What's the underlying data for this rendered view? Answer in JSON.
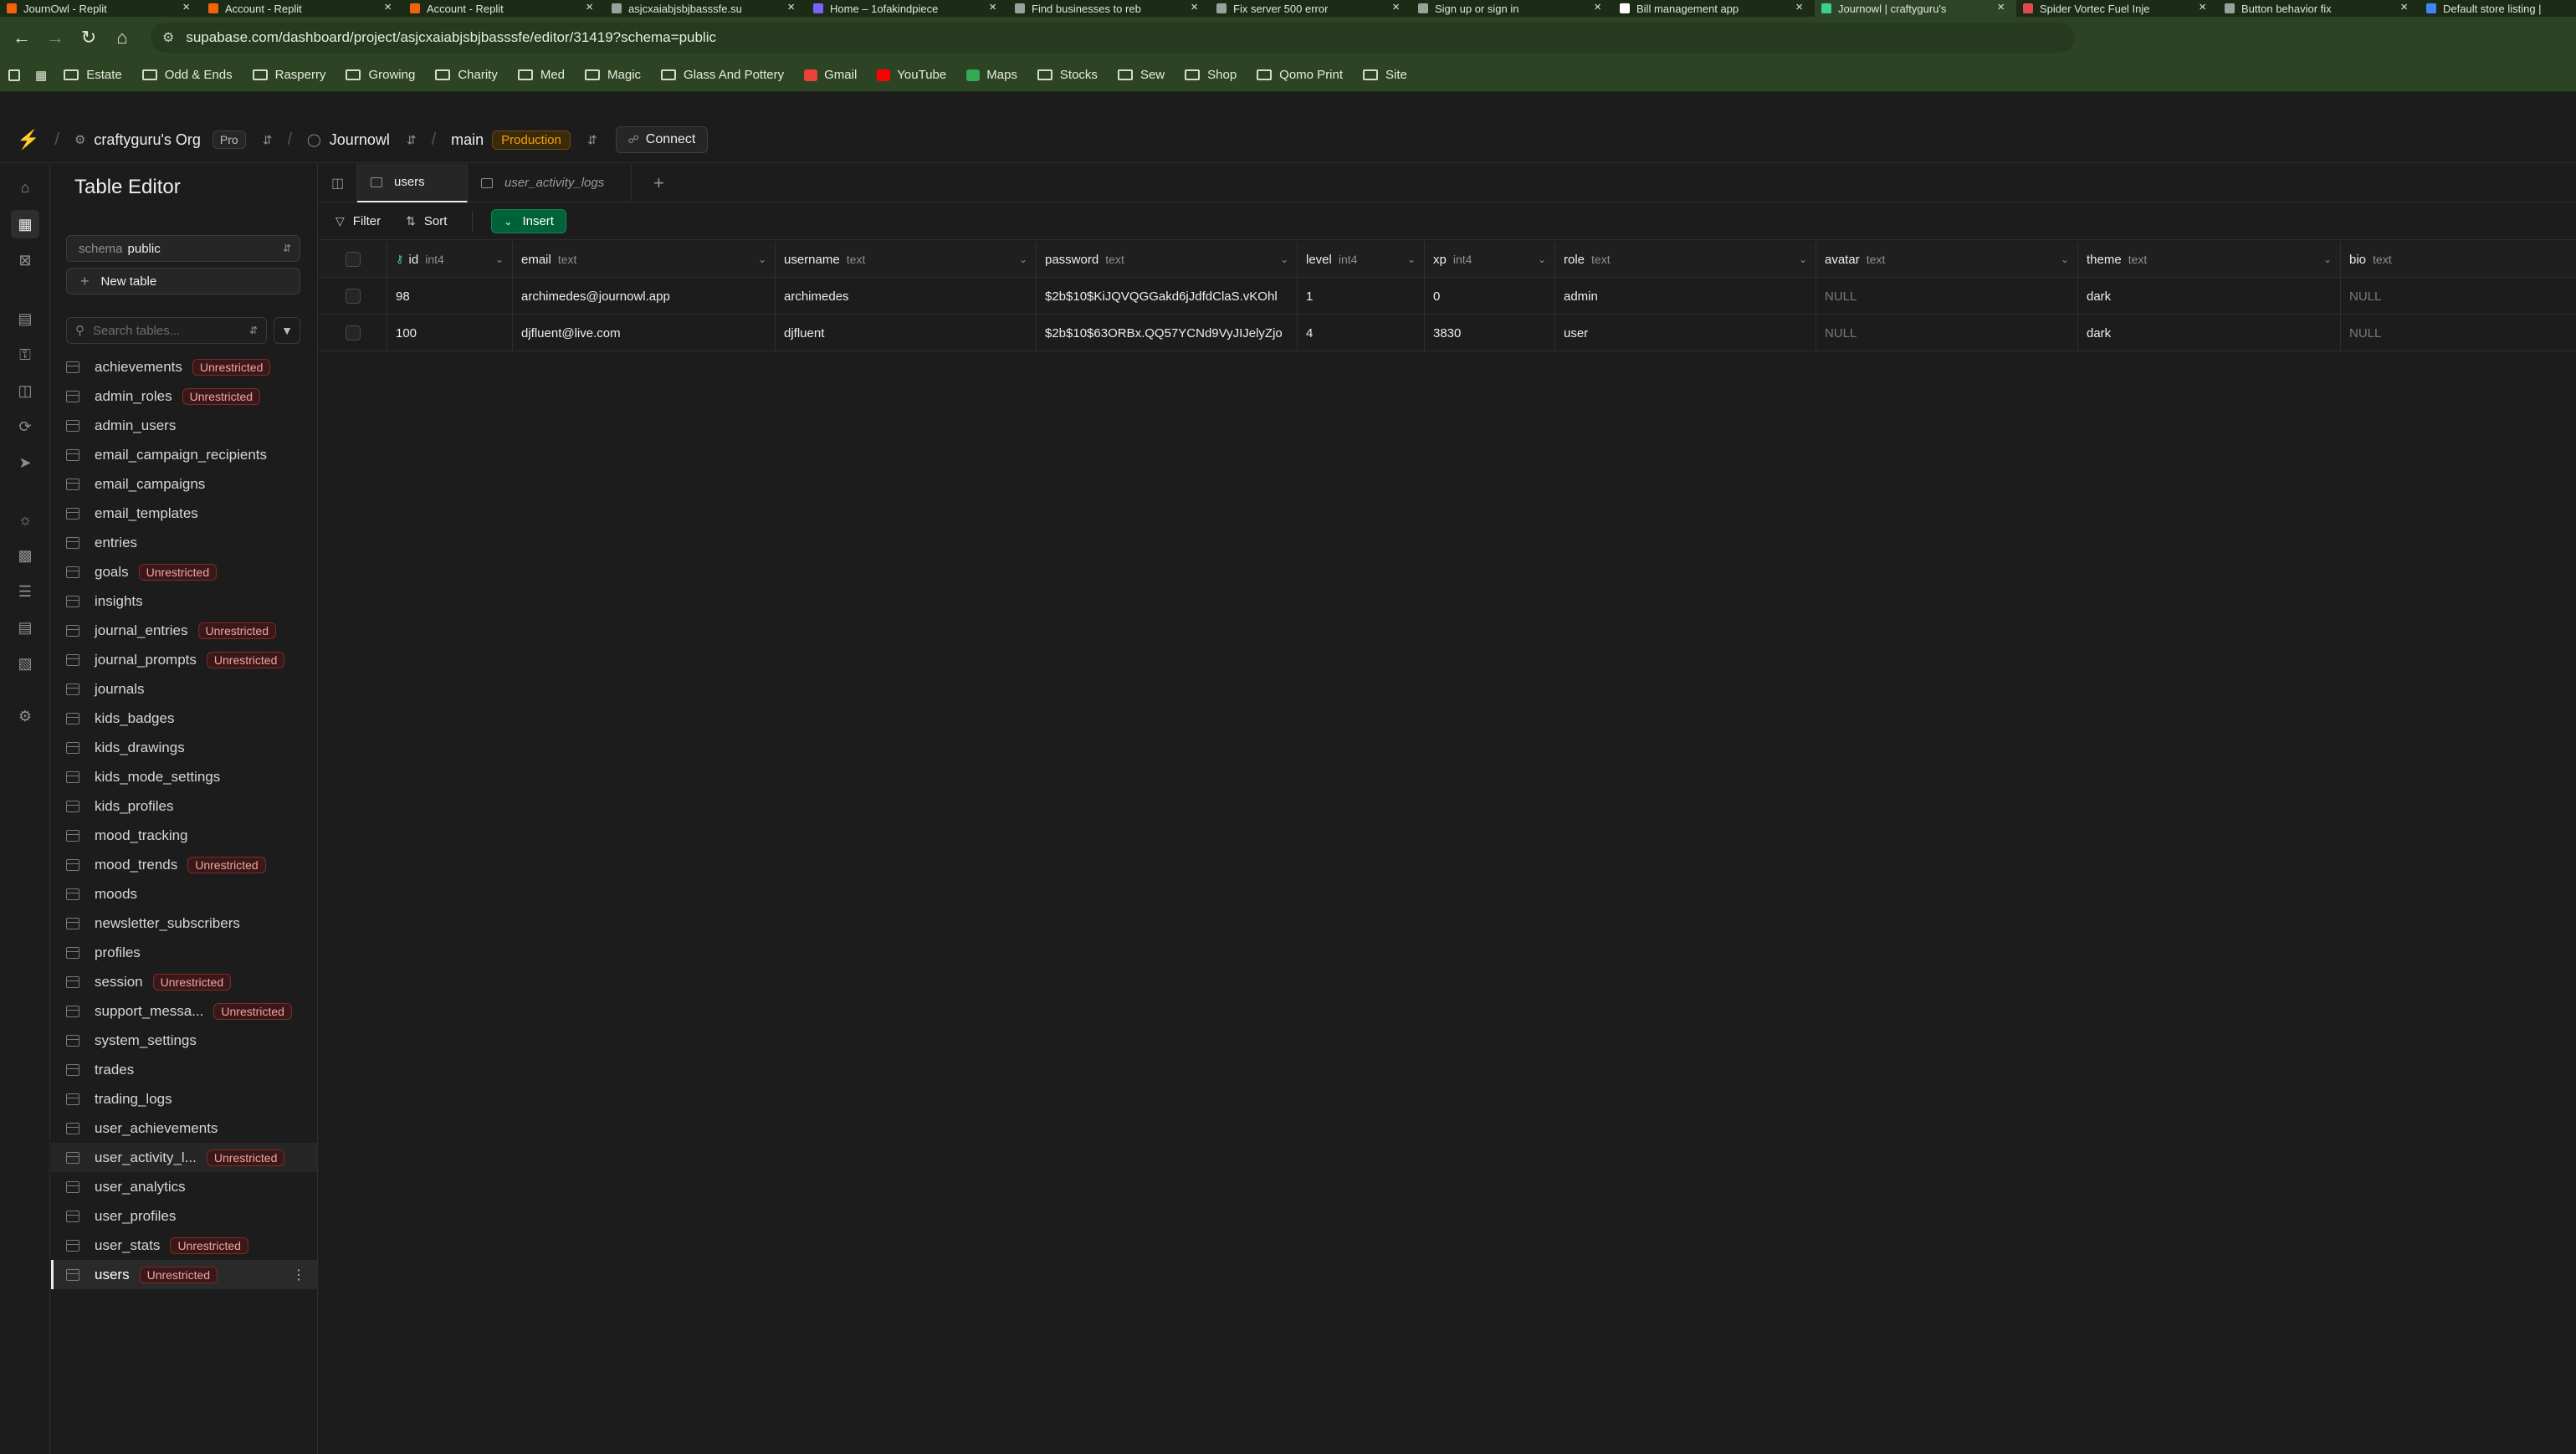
{
  "browser": {
    "tabs": [
      {
        "title": "JournOwl - Replit",
        "color": "#f26207"
      },
      {
        "title": "Account - Replit",
        "color": "#f26207"
      },
      {
        "title": "Account - Replit",
        "color": "#f26207"
      },
      {
        "title": "asjcxaiabjsbjbasssfe.su",
        "color": "#9aa19a"
      },
      {
        "title": "Home – 1ofakindpiece",
        "color": "#7b61ff"
      },
      {
        "title": "Find businesses to reb",
        "color": "#9aa19a"
      },
      {
        "title": "Fix server 500 error",
        "color": "#9aa19a"
      },
      {
        "title": "Sign up or sign in",
        "color": "#9aa19a"
      },
      {
        "title": "Bill management app",
        "color": "#ffffff"
      },
      {
        "title": "Journowl | craftyguru's",
        "color": "#3ecf8e"
      },
      {
        "title": "Spider Vortec Fuel Inje",
        "color": "#e04a4a"
      },
      {
        "title": "Button behavior fix",
        "color": "#9aa19a"
      },
      {
        "title": "Default store listing | ",
        "color": "#4285f4"
      }
    ],
    "active_tab_index": 9,
    "url": "supabase.com/dashboard/project/asjcxaiabjsbjbasssfe/editor/31419?schema=public",
    "bookmarks": [
      "Estate",
      "Odd & Ends",
      "Rasperry",
      "Growing",
      "Charity",
      "Med",
      "Magic",
      "Glass And Pottery",
      "Gmail",
      "YouTube",
      "Maps",
      "Stocks",
      "Sew",
      "Shop",
      "Qomo Print",
      "Site"
    ]
  },
  "topbar": {
    "org": "craftyguru's Org",
    "plan": "Pro",
    "project": "Journowl",
    "branch": "main",
    "env": "Production",
    "connect": "Connect"
  },
  "sidebar": {
    "title": "Table Editor",
    "schema_label": "schema",
    "schema_value": "public",
    "new_table": "New table",
    "search_placeholder": "Search tables...",
    "unrestricted_label": "Unrestricted",
    "tables": [
      {
        "name": "achievements",
        "unrestricted": true
      },
      {
        "name": "admin_roles",
        "unrestricted": true
      },
      {
        "name": "admin_users",
        "unrestricted": false
      },
      {
        "name": "email_campaign_recipients",
        "unrestricted": false
      },
      {
        "name": "email_campaigns",
        "unrestricted": false
      },
      {
        "name": "email_templates",
        "unrestricted": false
      },
      {
        "name": "entries",
        "unrestricted": false
      },
      {
        "name": "goals",
        "unrestricted": true
      },
      {
        "name": "insights",
        "unrestricted": false
      },
      {
        "name": "journal_entries",
        "unrestricted": true
      },
      {
        "name": "journal_prompts",
        "unrestricted": true
      },
      {
        "name": "journals",
        "unrestricted": false
      },
      {
        "name": "kids_badges",
        "unrestricted": false
      },
      {
        "name": "kids_drawings",
        "unrestricted": false
      },
      {
        "name": "kids_mode_settings",
        "unrestricted": false
      },
      {
        "name": "kids_profiles",
        "unrestricted": false
      },
      {
        "name": "mood_tracking",
        "unrestricted": false
      },
      {
        "name": "mood_trends",
        "unrestricted": true
      },
      {
        "name": "moods",
        "unrestricted": false
      },
      {
        "name": "newsletter_subscribers",
        "unrestricted": false
      },
      {
        "name": "profiles",
        "unrestricted": false
      },
      {
        "name": "session",
        "unrestricted": true
      },
      {
        "name": "support_messa...",
        "unrestricted": true
      },
      {
        "name": "system_settings",
        "unrestricted": false
      },
      {
        "name": "trades",
        "unrestricted": false
      },
      {
        "name": "trading_logs",
        "unrestricted": false
      },
      {
        "name": "user_achievements",
        "unrestricted": false
      },
      {
        "name": "user_activity_l...",
        "unrestricted": true
      },
      {
        "name": "user_analytics",
        "unrestricted": false
      },
      {
        "name": "user_profiles",
        "unrestricted": false
      },
      {
        "name": "user_stats",
        "unrestricted": true
      },
      {
        "name": "users",
        "unrestricted": true
      }
    ],
    "selected_index": 31,
    "hover_index": 27
  },
  "editor": {
    "tabs": [
      {
        "label": "users",
        "active": true,
        "italic": false
      },
      {
        "label": "user_activity_logs",
        "active": false,
        "italic": true
      }
    ],
    "toolbar": {
      "filter": "Filter",
      "sort": "Sort",
      "insert": "Insert"
    },
    "columns": [
      {
        "name": "id",
        "type": "int4",
        "key": true
      },
      {
        "name": "email",
        "type": "text"
      },
      {
        "name": "username",
        "type": "text"
      },
      {
        "name": "password",
        "type": "text"
      },
      {
        "name": "level",
        "type": "int4"
      },
      {
        "name": "xp",
        "type": "int4"
      },
      {
        "name": "role",
        "type": "text"
      },
      {
        "name": "avatar",
        "type": "text"
      },
      {
        "name": "theme",
        "type": "text"
      },
      {
        "name": "bio",
        "type": "text"
      }
    ],
    "rows": [
      [
        "98",
        "archimedes@journowl.app",
        "archimedes",
        "$2b$10$KiJQVQGGakd6jJdfdClaS.vKOhl",
        "1",
        "0",
        "admin",
        "NULL",
        "dark",
        "NULL"
      ],
      [
        "100",
        "djfluent@live.com",
        "djfluent",
        "$2b$10$63ORBx.QQ57YCNd9VyJIJelyZjo",
        "4",
        "3830",
        "user",
        "NULL",
        "dark",
        "NULL"
      ]
    ]
  }
}
